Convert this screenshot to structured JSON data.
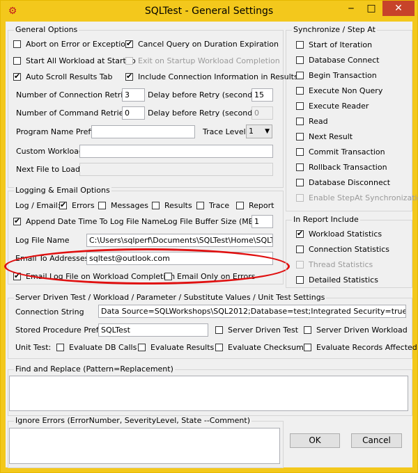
{
  "window": {
    "title": "SQLTest - General Settings"
  },
  "general_options": {
    "label": "General Options",
    "abort_on_error": "Abort on Error or Exception",
    "cancel_query": "Cancel Query on Duration Expiration",
    "start_all_workload": "Start All Workload at Startup",
    "exit_on_startup": "Exit on Startup Workload Completion",
    "auto_scroll": "Auto Scroll Results Tab",
    "include_connection": "Include Connection Information in Results",
    "num_connection_retries_label": "Number of Connection Retries",
    "num_connection_retries": "3",
    "delay_retry_label_1": "Delay before Retry (seconds)",
    "delay_retry_1": "15",
    "num_command_retries_label": "Number of Command Retries",
    "num_command_retries": "0",
    "delay_retry_label_2": "Delay before Retry (seconds)",
    "delay_retry_2": "0",
    "program_name_prefix_label": "Program Name Prefix",
    "program_name_prefix": "",
    "trace_level_label": "Trace Level",
    "trace_level": "1",
    "custom_workload_label": "Custom Workload",
    "custom_workload": "",
    "next_file_label": "Next File to Load",
    "next_file": ""
  },
  "sync": {
    "label": "Synchronize / Step At",
    "items": [
      "Start of Iteration",
      "Database Connect",
      "Begin Transaction",
      "Execute Non Query",
      "Execute Reader",
      "Read",
      "Next Result",
      "Commit Transaction",
      "Rollback Transaction",
      "Database Disconnect",
      "Enable StepAt Synchronization"
    ]
  },
  "logging": {
    "label": "Logging & Email Options",
    "log_email_label": "Log / Email:",
    "errors": "Errors",
    "messages": "Messages",
    "results": "Results",
    "trace": "Trace",
    "report": "Report",
    "append_date": "Append Date Time To Log File Name",
    "buffer_label": "Log File Buffer Size (MB)",
    "buffer_size": "1",
    "log_file_name_label": "Log File Name",
    "log_file_name": "C:\\Users\\sqlperf\\Documents\\SQLTest\\Home\\SQLTest.",
    "email_to_label": "Email To Addresses",
    "email_to": "sqltest@outlook.com",
    "email_log_file": "Email Log File on Workload Completion",
    "email_only_errors": "Email Only on Errors"
  },
  "report_include": {
    "label": "In Report Include",
    "workload_stats": "Workload Statistics",
    "connection_stats": "Connection Statistics",
    "thread_stats": "Thread Statistics",
    "detailed_stats": "Detailed Statistics"
  },
  "server_driven": {
    "label": "Server Driven Test / Workload / Parameter / Substitute Values / Unit Test Settings",
    "connection_string_label": "Connection String",
    "connection_string": "Data Source=SQLWorkshops\\SQL2012;Database=test;Integrated Security=true",
    "sp_prefix_label": "Stored Procedure Prefix",
    "sp_prefix": "SQLTest",
    "server_driven_test": "Server Driven Test",
    "server_driven_workload": "Server Driven Workload",
    "unit_test_label": "Unit Test:",
    "eval_db_calls": "Evaluate DB Calls",
    "eval_results": "Evaluate Results",
    "eval_checksum": "Evaluate Checksum",
    "eval_records": "Evaluate Records Affected"
  },
  "find_replace": {
    "label": "Find and Replace (Pattern=Replacement)",
    "value": ""
  },
  "ignore_errors": {
    "label": "Ignore Errors (ErrorNumber, SeverityLevel, State --Comment)",
    "value": ""
  },
  "buttons": {
    "ok": "OK",
    "cancel": "Cancel"
  },
  "colors": {
    "title_bar": "#f3c81c",
    "close_button": "#c7432a",
    "highlight_ellipse": "#e01010"
  }
}
